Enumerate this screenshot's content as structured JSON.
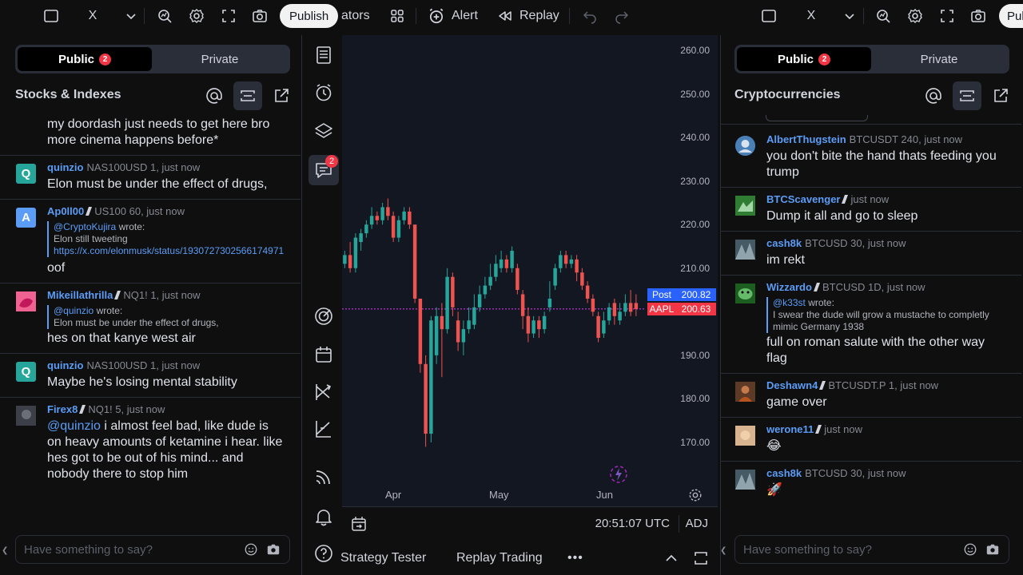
{
  "toolbar": {
    "left": {
      "symbol_close": "X",
      "publish_label": "Publish",
      "indicators_partial": "ators",
      "alert_label": "Alert",
      "replay_label": "Replay"
    },
    "right": {
      "symbol_close": "X",
      "publish_partial": "Pul"
    }
  },
  "left_panel": {
    "tab_public": "Public",
    "tab_public_badge": "2",
    "tab_private": "Private",
    "room_title": "Stocks & Indexes",
    "input_placeholder": "Have something to say?",
    "messages": [
      {
        "text": "my doordash just needs to get here bro more cinema happens before*"
      },
      {
        "avatar_letter": "Q",
        "avatar_color": "#26a69a",
        "user": "quinzio",
        "meta": "NAS100USD 1, just now",
        "text": "Elon must be under the effect of drugs,"
      },
      {
        "avatar_letter": "A",
        "avatar_color": "#5b9cf6",
        "user": "Ap0ll00",
        "meta": "US100 60, just now",
        "quote_user": "@CryptoKujira",
        "quote_wrote": "wrote:",
        "quote_text": "Elon still tweeting",
        "quote_link": "https://x.com/elonmusk/status/1930727302566174971",
        "text": "oof"
      },
      {
        "avatar_color": "#e91e63",
        "user": "Mikeillathrilla",
        "meta": "NQ1! 1, just now",
        "quote_user": "@quinzio",
        "quote_wrote": "wrote:",
        "quote_text": "Elon must be under the effect of drugs,",
        "text": "hes on that kanye west air"
      },
      {
        "avatar_letter": "Q",
        "avatar_color": "#26a69a",
        "user": "quinzio",
        "meta": "NAS100USD 1, just now",
        "text": "Maybe he's losing mental stability"
      },
      {
        "avatar_color": "#555b66",
        "user": "Firex8",
        "meta": "NQ1! 5, just now",
        "mention": "@quinzio",
        "text": " i almost feel bad, like dude is on heavy amounts of ketamine i hear. like hes got to be out of his mind... and nobody there to stop him"
      }
    ]
  },
  "right_panel": {
    "tab_public": "Public",
    "tab_public_badge": "2",
    "tab_private": "Private",
    "room_title": "Cryptocurrencies",
    "input_placeholder": "Have something to say?",
    "messages": [
      {
        "avatar_color": "#3a6ea5",
        "user": "AlbertThugstein",
        "meta": "BTCUSDT 240, just now",
        "text": "you don't bite the hand thats feeding you trump"
      },
      {
        "avatar_color": "#4caf50",
        "user": "BTCScavenger",
        "meta": "just now",
        "text": "Dump it all and go to sleep"
      },
      {
        "avatar_color": "#607d8b",
        "user": "cash8k",
        "meta": "BTCUSD 30, just now",
        "text": "im rekt"
      },
      {
        "avatar_color": "#2e7d32",
        "user": "Wizzardo",
        "meta": "BTCUSD 1D, just now",
        "quote_user": "@k33st",
        "quote_wrote": "wrote:",
        "quote_text": "I swear the dude will grow a mustache to completly mimic Germany 1938",
        "text": "full on roman salute with the other way flag"
      },
      {
        "avatar_color": "#8d4a2c",
        "user": "Deshawn4",
        "meta": "BTCUSDT.P 1, just now",
        "text": "game over"
      },
      {
        "avatar_color": "#c9a27a",
        "user": "werone11",
        "meta": "just now",
        "text": "😂"
      },
      {
        "avatar_color": "#607d8b",
        "user": "cash8k",
        "meta": "BTCUSD 30, just now",
        "text": "🚀"
      }
    ]
  },
  "vertical_toolbar": {
    "chat_badge": "2"
  },
  "chart": {
    "price_labels": [
      "260.00",
      "250.00",
      "240.00",
      "230.00",
      "220.00",
      "210.00",
      "200.00",
      "190.00",
      "180.00",
      "170.00"
    ],
    "time_labels": [
      "Apr",
      "May",
      "Jun"
    ],
    "post_label": "Post",
    "post_value": "200.82",
    "symbol_label": "AAPL",
    "symbol_value": "200.63",
    "clock": "20:51:07 UTC",
    "adj_label": "ADJ",
    "colors": {
      "up": "#26a69a",
      "down": "#ef5350",
      "post": "#2962ff",
      "last": "#f23645"
    }
  },
  "chart_data": {
    "type": "candlestick",
    "symbol": "AAPL",
    "xlabel": "",
    "ylabel": "",
    "ylim": [
      165,
      263
    ],
    "x_ticks": [
      "Apr",
      "May",
      "Jun"
    ],
    "y_ticks": [
      170,
      180,
      190,
      200,
      210,
      220,
      230,
      240,
      250,
      260
    ],
    "last_price": 200.63,
    "post_price": 200.82,
    "candles": [
      {
        "o": 211,
        "c": 213,
        "h": 214,
        "l": 210
      },
      {
        "o": 213,
        "c": 210,
        "h": 216,
        "l": 209
      },
      {
        "o": 210,
        "c": 217,
        "h": 218,
        "l": 209
      },
      {
        "o": 216,
        "c": 218,
        "h": 219,
        "l": 214
      },
      {
        "o": 218,
        "c": 220,
        "h": 221,
        "l": 217
      },
      {
        "o": 220,
        "c": 222,
        "h": 224,
        "l": 219
      },
      {
        "o": 222,
        "c": 221,
        "h": 223,
        "l": 220
      },
      {
        "o": 221,
        "c": 224,
        "h": 225,
        "l": 220
      },
      {
        "o": 224,
        "c": 222,
        "h": 226,
        "l": 221
      },
      {
        "o": 222,
        "c": 217,
        "h": 223,
        "l": 216
      },
      {
        "o": 217,
        "c": 221,
        "h": 222,
        "l": 216
      },
      {
        "o": 221,
        "c": 223,
        "h": 224,
        "l": 220
      },
      {
        "o": 223,
        "c": 220,
        "h": 224,
        "l": 219
      },
      {
        "o": 220,
        "c": 203,
        "h": 204,
        "l": 202
      },
      {
        "o": 203,
        "c": 188,
        "h": 200,
        "l": 186
      },
      {
        "o": 188,
        "c": 172,
        "h": 190,
        "l": 169
      },
      {
        "o": 172,
        "c": 198,
        "h": 199,
        "l": 170
      },
      {
        "o": 190,
        "c": 199,
        "h": 201,
        "l": 188
      },
      {
        "o": 199,
        "c": 196,
        "h": 202,
        "l": 185
      },
      {
        "o": 196,
        "c": 208,
        "h": 210,
        "l": 195
      },
      {
        "o": 208,
        "c": 201,
        "h": 209,
        "l": 199
      },
      {
        "o": 198,
        "c": 193,
        "h": 200,
        "l": 191
      },
      {
        "o": 193,
        "c": 196,
        "h": 198,
        "l": 190
      },
      {
        "o": 196,
        "c": 198,
        "h": 201,
        "l": 195
      },
      {
        "o": 197,
        "c": 201,
        "h": 204,
        "l": 196
      },
      {
        "o": 201,
        "c": 204,
        "h": 206,
        "l": 200
      },
      {
        "o": 204,
        "c": 206,
        "h": 208,
        "l": 203
      },
      {
        "o": 206,
        "c": 208,
        "h": 211,
        "l": 205
      },
      {
        "o": 208,
        "c": 211,
        "h": 213,
        "l": 207
      },
      {
        "o": 210,
        "c": 212,
        "h": 214,
        "l": 209
      },
      {
        "o": 212,
        "c": 210,
        "h": 213,
        "l": 209
      },
      {
        "o": 210,
        "c": 214,
        "h": 215,
        "l": 209
      },
      {
        "o": 210,
        "c": 205,
        "h": 211,
        "l": 204
      },
      {
        "o": 204,
        "c": 199,
        "h": 205,
        "l": 196
      },
      {
        "o": 199,
        "c": 195,
        "h": 201,
        "l": 193
      },
      {
        "o": 195,
        "c": 198,
        "h": 199,
        "l": 194
      },
      {
        "o": 198,
        "c": 196,
        "h": 199,
        "l": 194
      },
      {
        "o": 196,
        "c": 199,
        "h": 200,
        "l": 195
      },
      {
        "o": 201,
        "c": 203,
        "h": 207,
        "l": 200
      },
      {
        "o": 206,
        "c": 210,
        "h": 211,
        "l": 205
      },
      {
        "o": 210,
        "c": 213,
        "h": 214,
        "l": 209
      },
      {
        "o": 213,
        "c": 211,
        "h": 214,
        "l": 210
      },
      {
        "o": 211,
        "c": 212,
        "h": 213,
        "l": 210
      },
      {
        "o": 212,
        "c": 209,
        "h": 213,
        "l": 207
      },
      {
        "o": 209,
        "c": 206,
        "h": 210,
        "l": 205
      },
      {
        "o": 206,
        "c": 203,
        "h": 207,
        "l": 202
      },
      {
        "o": 203,
        "c": 200,
        "h": 204,
        "l": 199
      },
      {
        "o": 199,
        "c": 194,
        "h": 200,
        "l": 193
      },
      {
        "o": 195,
        "c": 198,
        "h": 200,
        "l": 194
      },
      {
        "o": 198,
        "c": 201,
        "h": 202,
        "l": 197
      },
      {
        "o": 202,
        "c": 199,
        "h": 203,
        "l": 197
      },
      {
        "o": 198,
        "c": 200,
        "h": 202,
        "l": 197
      },
      {
        "o": 200,
        "c": 202,
        "h": 204,
        "l": 199
      },
      {
        "o": 202,
        "c": 200,
        "h": 205,
        "l": 199
      },
      {
        "o": 202,
        "c": 200.63,
        "h": 204,
        "l": 199
      }
    ]
  }
}
